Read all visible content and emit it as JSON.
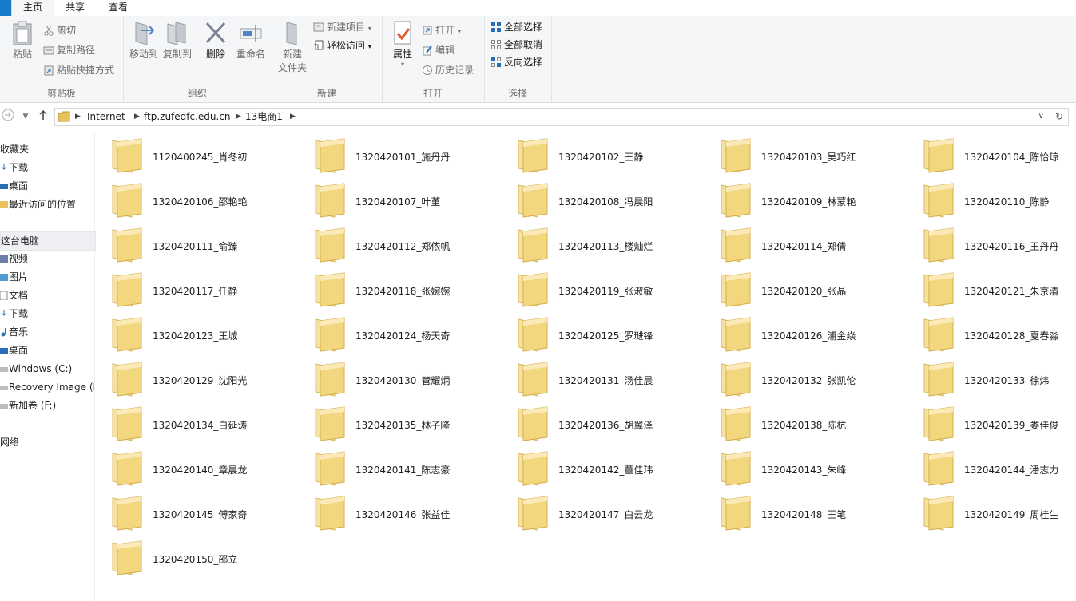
{
  "tabs": [
    "主页",
    "共享",
    "查看"
  ],
  "ribbon": {
    "clipboard": {
      "label": "剪贴板",
      "paste": "粘贴",
      "cut": "剪切",
      "copy_path": "复制路径",
      "paste_shortcut": "粘贴快捷方式"
    },
    "organize": {
      "label": "组织",
      "move_to": "移动到",
      "copy_to": "复制到",
      "delete": "删除",
      "rename": "重命名"
    },
    "new": {
      "label": "新建",
      "new_folder_line1": "新建",
      "new_folder_line2": "文件夹",
      "new_item": "新建项目",
      "easy_access": "轻松访问"
    },
    "open": {
      "label": "打开",
      "properties": "属性",
      "open": "打开",
      "edit": "编辑",
      "history": "历史记录"
    },
    "select": {
      "label": "选择",
      "select_all": "全部选择",
      "select_none": "全部取消",
      "invert": "反向选择"
    }
  },
  "address": {
    "crumbs": [
      "Internet",
      "ftp.zufedfc.edu.cn",
      "13电商1"
    ]
  },
  "sidebar": {
    "items": [
      {
        "label": "收藏夹"
      },
      {
        "label": "下载"
      },
      {
        "label": "桌面"
      },
      {
        "label": "最近访问的位置"
      },
      {
        "label": "这台电脑"
      },
      {
        "label": "视频"
      },
      {
        "label": "图片"
      },
      {
        "label": "文档"
      },
      {
        "label": "下载"
      },
      {
        "label": "音乐"
      },
      {
        "label": "桌面"
      },
      {
        "label": "Windows (C:)"
      },
      {
        "label": "Recovery Image (D"
      },
      {
        "label": "新加卷 (F:)"
      },
      {
        "label": "网络"
      }
    ]
  },
  "folders": [
    "1120400245_肖冬初",
    "1320420101_施丹丹",
    "1320420102_王静",
    "1320420103_吴巧红",
    "1320420104_陈怡琼",
    "1320420106_邵艳艳",
    "1320420107_叶堇",
    "1320420108_冯晨阳",
    "1320420109_林蒙艳",
    "1320420110_陈静",
    "1320420111_俞臻",
    "1320420112_郑依帆",
    "1320420113_楼灿烂",
    "1320420114_郑倩",
    "1320420116_王丹丹",
    "1320420117_任静",
    "1320420118_张婉婉",
    "1320420119_张淑敏",
    "1320420120_张晶",
    "1320420121_朱京清",
    "1320420123_王城",
    "1320420124_杨天奇",
    "1320420125_罗琎锋",
    "1320420126_浦金焱",
    "1320420128_夏春淼",
    "1320420129_沈阳光",
    "1320420130_管耀炳",
    "1320420131_汤佳晨",
    "1320420132_张凯伦",
    "1320420133_徐炜",
    "1320420134_白延涛",
    "1320420135_林子隆",
    "1320420136_胡翼泽",
    "1320420138_陈杭",
    "1320420139_娄佳俊",
    "1320420140_章晨龙",
    "1320420141_陈志豪",
    "1320420142_董佳玮",
    "1320420143_朱峰",
    "1320420144_潘志力",
    "1320420145_傅家奇",
    "1320420146_张益佳",
    "1320420147_白云龙",
    "1320420148_王笔",
    "1320420149_周桂生",
    "1320420150_邵立"
  ]
}
